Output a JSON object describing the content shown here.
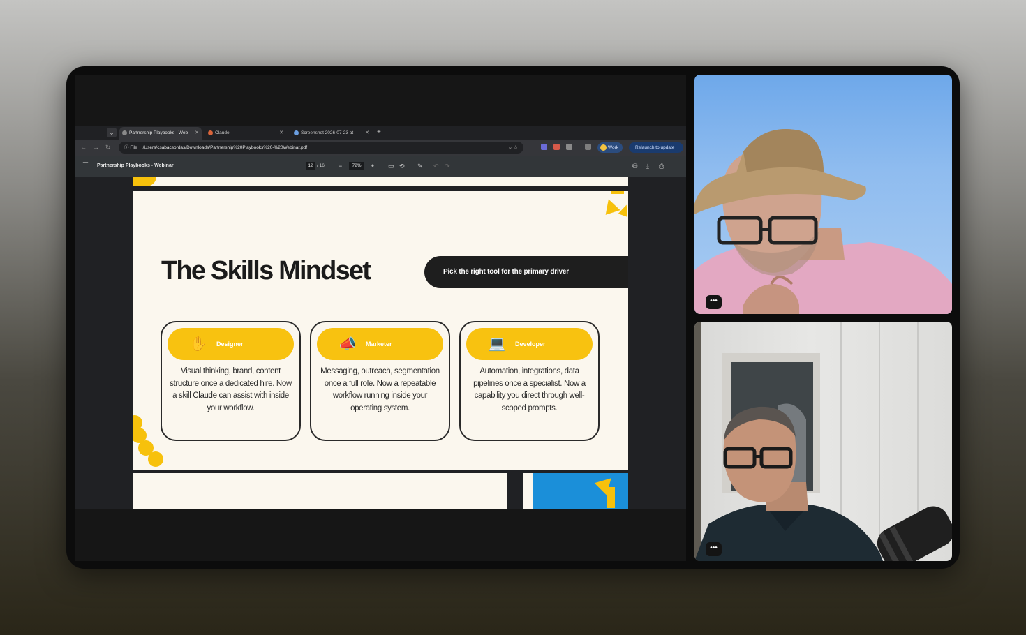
{
  "browser": {
    "tabs": [
      {
        "label": "Partnership Playbooks - Web",
        "active": true
      },
      {
        "label": "Claude",
        "active": false
      },
      {
        "label": "Screenshot 2026-07-23 at",
        "active": false
      }
    ],
    "address": {
      "chip": "File",
      "url": "/Users/csabacsordas/Downloads/Partnership%20Playbooks%20-%20Webinar.pdf"
    },
    "profile_label": "Work",
    "relaunch_label": "Relaunch to update"
  },
  "pdf_toolbar": {
    "title": "Partnership Playbooks - Webinar",
    "page_current": "12",
    "page_total": "/ 16",
    "zoom": "72%"
  },
  "slide": {
    "title": "The Skills Mindset",
    "pill_text": "Pick the right tool for the primary driver",
    "cards": [
      {
        "icon": "palette-hand-icon",
        "label": "Designer",
        "body": "Visual thinking, brand, content structure once a dedicated hire. Now a skill Claude can assist with inside your workflow."
      },
      {
        "icon": "megaphone-icon",
        "label": "Marketer",
        "body": "Messaging, outreach, segmentation once a full role. Now a repeatable workflow running inside your operating system."
      },
      {
        "icon": "developer-laptop-icon",
        "label": "Developer",
        "body": "Automation, integrations, data pipelines once a specialist. Now a capability you direct through well-scoped prompts."
      }
    ],
    "colors": {
      "accent": "#f8c210",
      "dark": "#1e1e1e",
      "paper": "#fbf7ee",
      "blue": "#1b8fd9"
    }
  },
  "video_tiles": [
    {
      "more_label": "•••"
    },
    {
      "more_label": "•••"
    }
  ]
}
